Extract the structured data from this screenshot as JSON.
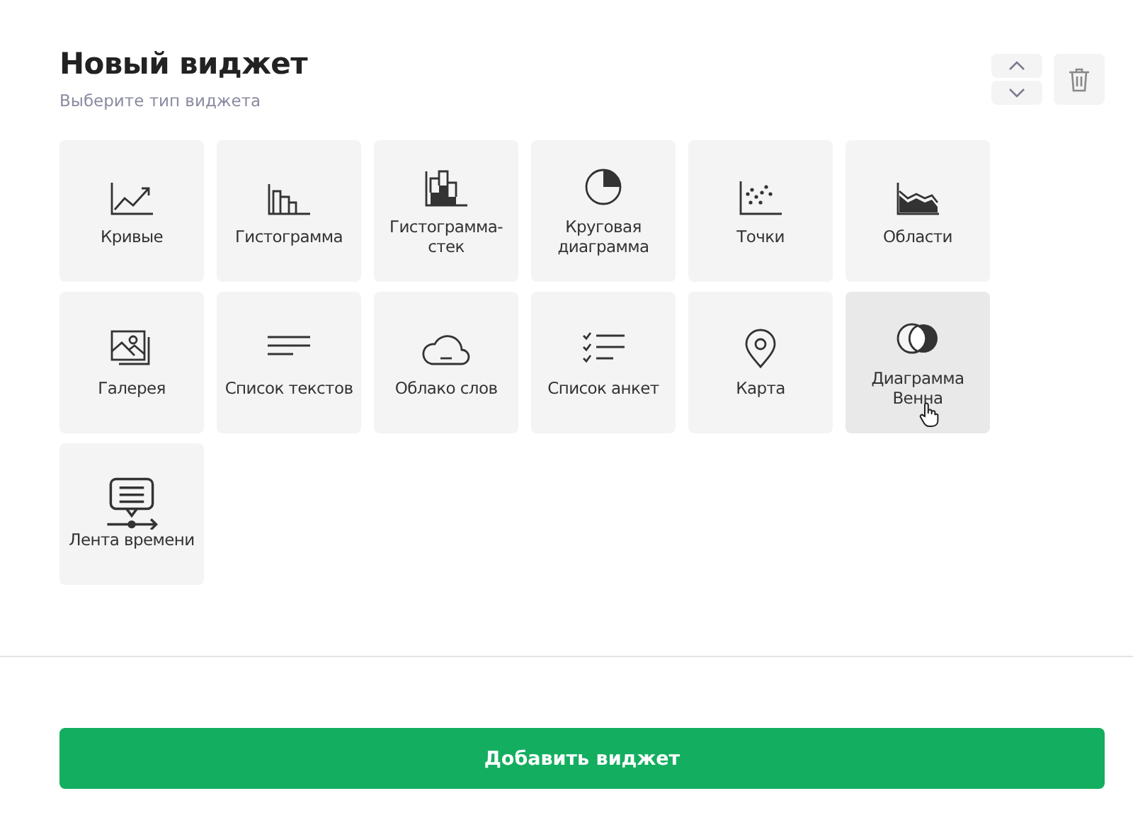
{
  "header": {
    "title": "Новый виджет",
    "subtitle": "Выберите тип виджета"
  },
  "widgets": [
    {
      "kind": "lines",
      "label": "Кривые",
      "hovered": false
    },
    {
      "kind": "histogram",
      "label": "Гистограмма",
      "hovered": false
    },
    {
      "kind": "stacked",
      "label": "Гистограмма-стек",
      "hovered": false
    },
    {
      "kind": "pie",
      "label": "Круговая диаграмма",
      "hovered": false
    },
    {
      "kind": "scatter",
      "label": "Точки",
      "hovered": false
    },
    {
      "kind": "area",
      "label": "Области",
      "hovered": false
    },
    {
      "kind": "gallery",
      "label": "Галерея",
      "hovered": false
    },
    {
      "kind": "textlist",
      "label": "Список текстов",
      "hovered": false
    },
    {
      "kind": "cloud",
      "label": "Облако слов",
      "hovered": false
    },
    {
      "kind": "checklist",
      "label": "Список анкет",
      "hovered": false
    },
    {
      "kind": "map",
      "label": "Карта",
      "hovered": false
    },
    {
      "kind": "venn",
      "label": "Диаграмма Венна",
      "hovered": true
    },
    {
      "kind": "timeline",
      "label": "Лента времени",
      "hovered": false
    }
  ],
  "submit": {
    "label": "Добавить виджет"
  }
}
